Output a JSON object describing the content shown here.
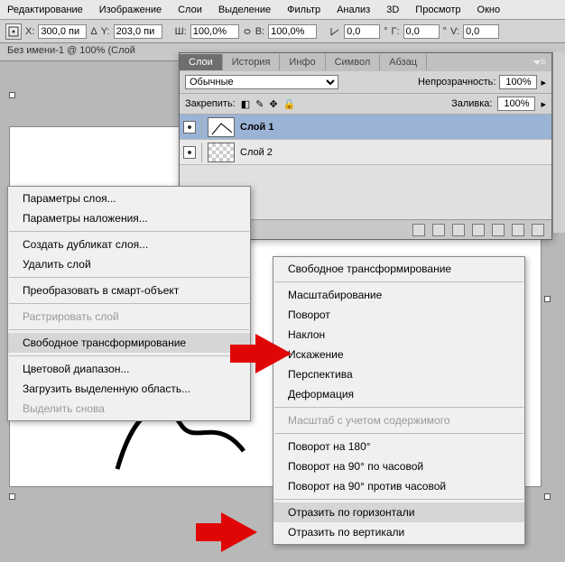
{
  "menubar": [
    "Редактирование",
    "Изображение",
    "Слои",
    "Выделение",
    "Фильтр",
    "Анализ",
    "3D",
    "Просмотр",
    "Окно"
  ],
  "options": {
    "x_label": "X:",
    "x": "300,0 пи",
    "y_label": "Y:",
    "y": "203,0 пи",
    "w_label": "Ш:",
    "w": "100,0%",
    "h_label": "В:",
    "h": "100,0%",
    "a_label": "Δ",
    "a": "0,0",
    "g_label": "Г:",
    "g": "0,0",
    "v_label": "V:",
    "v": "0,0",
    "deg": "°"
  },
  "doc_tab": "Без имени-1 @ 100% (Слой",
  "layers_panel": {
    "tabs": [
      "Слои",
      "История",
      "Инфо",
      "Символ",
      "Абзац"
    ],
    "active_tab": 0,
    "mode": "Обычные",
    "opacity_label": "Непрозрачность:",
    "opacity": "100%",
    "lock_label": "Закрепить:",
    "fill_label": "Заливка:",
    "fill": "100%",
    "layers": [
      {
        "name": "Слой 1",
        "selected": true,
        "checker": false
      },
      {
        "name": "Слой 2",
        "selected": false,
        "checker": true
      }
    ]
  },
  "context1": [
    {
      "t": "Параметры слоя...",
      "type": "item"
    },
    {
      "t": "Параметры наложения...",
      "type": "item"
    },
    {
      "type": "sep"
    },
    {
      "t": "Создать дубликат слоя...",
      "type": "item"
    },
    {
      "t": "Удалить слой",
      "type": "item"
    },
    {
      "type": "sep"
    },
    {
      "t": "Преобразовать в смарт-объект",
      "type": "item"
    },
    {
      "type": "sep"
    },
    {
      "t": "Растрировать слой",
      "type": "item",
      "disabled": true
    },
    {
      "type": "sep"
    },
    {
      "t": "Свободное трансформирование",
      "type": "item",
      "hl": true
    },
    {
      "type": "sep"
    },
    {
      "t": "Цветовой диапазон...",
      "type": "item"
    },
    {
      "t": "Загрузить выделенную область...",
      "type": "item"
    },
    {
      "t": "Выделить снова",
      "type": "item",
      "disabled": true
    }
  ],
  "context2": [
    {
      "t": "Свободное трансформирование",
      "type": "item"
    },
    {
      "type": "sep"
    },
    {
      "t": "Масштабирование",
      "type": "item"
    },
    {
      "t": "Поворот",
      "type": "item"
    },
    {
      "t": "Наклон",
      "type": "item"
    },
    {
      "t": "Искажение",
      "type": "item"
    },
    {
      "t": "Перспектива",
      "type": "item"
    },
    {
      "t": "Деформация",
      "type": "item"
    },
    {
      "type": "sep"
    },
    {
      "t": "Масштаб с учетом содержимого",
      "type": "item",
      "disabled": true
    },
    {
      "type": "sep"
    },
    {
      "t": "Поворот на 180°",
      "type": "item"
    },
    {
      "t": "Поворот на 90° по часовой",
      "type": "item"
    },
    {
      "t": "Поворот на 90° против часовой",
      "type": "item"
    },
    {
      "type": "sep"
    },
    {
      "t": "Отразить по горизонтали",
      "type": "item",
      "hl": true
    },
    {
      "t": "Отразить по вертикали",
      "type": "item"
    }
  ]
}
